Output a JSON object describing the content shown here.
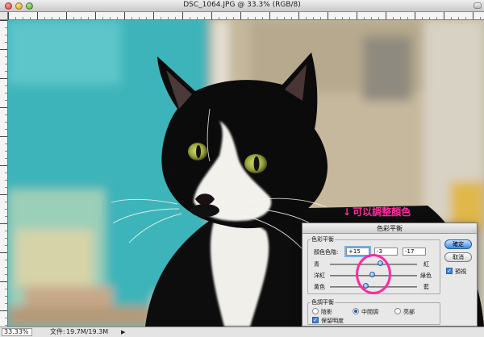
{
  "window": {
    "title": "DSC_1064.JPG @ 33.3% (RGB/8)"
  },
  "status": {
    "zoom": "33.33%",
    "doc_label": "文件:",
    "doc_size": "19.7M/19.3M",
    "arrow": "▶"
  },
  "annotation": {
    "arrow": "↓",
    "text": "可以調整顏色"
  },
  "dialog": {
    "title": "色彩平衡",
    "color_balance_group": "色彩平衡",
    "levels_label": "顏色色階:",
    "levels": [
      "+15",
      "-3",
      "-17"
    ],
    "sliders": [
      {
        "left": "青",
        "right": "紅",
        "value": 15
      },
      {
        "left": "洋紅",
        "right": "綠色",
        "value": -3
      },
      {
        "left": "黃色",
        "right": "藍",
        "value": -17
      }
    ],
    "tone_group": "色調平衡",
    "tones": [
      {
        "label": "陰影",
        "selected": false
      },
      {
        "label": "中間調",
        "selected": true
      },
      {
        "label": "亮部",
        "selected": false
      }
    ],
    "preserve_luminosity": "保留明度",
    "ok": "確定",
    "cancel": "取消",
    "preview": "預視"
  },
  "colors": {
    "wall": "#3ab2b7",
    "annotation": "#ff2aa0",
    "accent": "#3a86df"
  }
}
